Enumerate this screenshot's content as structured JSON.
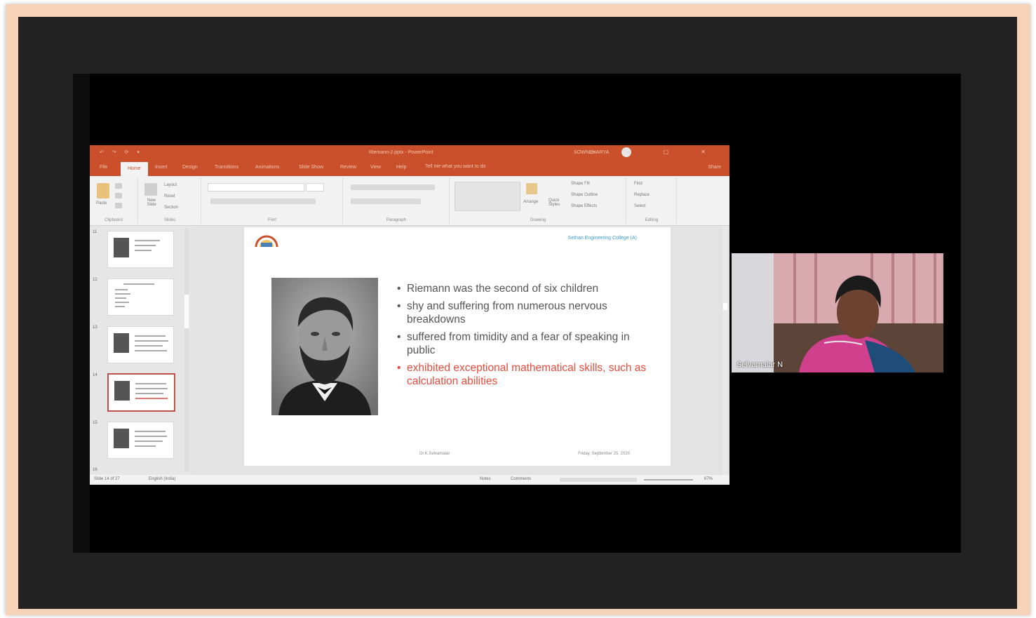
{
  "ppt": {
    "quick_access": "↶ ↷ ⟳ ▾",
    "doc_title": "Riemann-2.pptx - PowerPoint",
    "user_name": "SOWNDHARYA",
    "window_controls": "▭ – ▢ ✕",
    "tabs": [
      "File",
      "Home",
      "Insert",
      "Design",
      "Transitions",
      "Animations",
      "Slide Show",
      "Review",
      "View",
      "Help"
    ],
    "tell_me": "Tell me what you want to do",
    "share_label": "Share",
    "ribbon": {
      "paste": "Paste",
      "new_slide": "New Slide",
      "layout": "Layout",
      "reset": "Reset",
      "section": "Section",
      "arrange": "Arrange",
      "quick_styles": "Quick Styles",
      "shape_fill": "Shape Fill",
      "shape_outline": "Shape Outline",
      "shape_effects": "Shape Effects",
      "find": "Find",
      "replace": "Replace",
      "select": "Select",
      "groups": [
        "Clipboard",
        "Slides",
        "Font",
        "Paragraph",
        "Drawing",
        "Editing"
      ]
    },
    "thumbnails": [
      {
        "num": "11"
      },
      {
        "num": "12"
      },
      {
        "num": "13"
      },
      {
        "num": "14"
      },
      {
        "num": "15"
      },
      {
        "num": "16"
      }
    ],
    "slide": {
      "college": "Sethan Engineering College (A)",
      "bullets": [
        "Riemann was the second of six children",
        "shy and suffering from numerous nervous breakdowns",
        "suffered from timidity and a fear of speaking in public",
        "exhibited exceptional mathematical skills, such as calculation abilities"
      ],
      "footer_left": "Dr.K.Selvamalar",
      "footer_right": "Friday, September 25, 2020"
    },
    "status": {
      "slide_count": "Slide 14 of 27",
      "language": "English (India)",
      "notes": "Notes",
      "comments": "Comments",
      "zoom": "67%"
    }
  },
  "participant": {
    "name": "Selvamalar N"
  }
}
